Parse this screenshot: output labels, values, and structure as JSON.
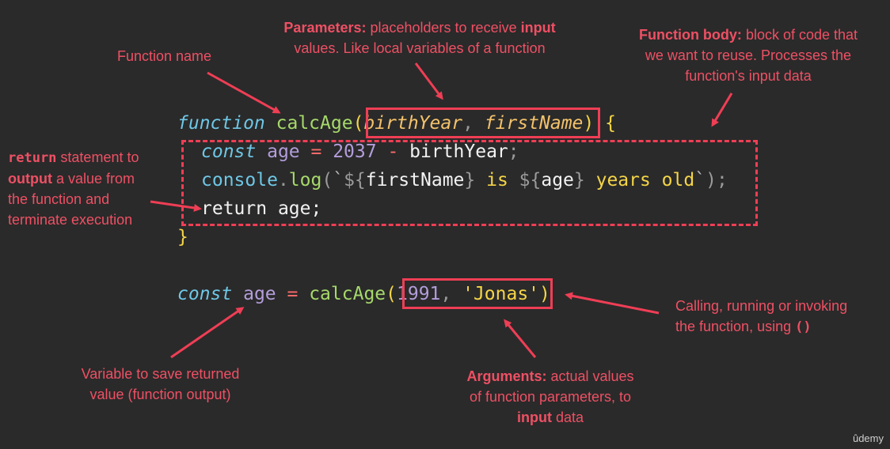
{
  "annotations": {
    "function_name": "Function name",
    "parameters": {
      "bold": "Parameters:",
      "text1": " placeholders to receive ",
      "bold2": "input",
      "line2": "values. Like local variables of a function"
    },
    "function_body": {
      "bold": "Function body:",
      "text1": " block of code that",
      "line2": "we want to reuse. Processes the",
      "line3": "function's input data"
    },
    "return_statement": {
      "mono": "return",
      "text1": " statement to",
      "bold2": "output",
      "text2": " a value from",
      "line3": "the function and",
      "line4": "terminate execution"
    },
    "calling": {
      "line1": "Calling, running or invoking",
      "line2": "the function, using ",
      "mono": "()"
    },
    "variable": {
      "line1": "Variable to save returned",
      "line2": "value (function output)"
    },
    "arguments": {
      "bold": "Arguments:",
      "text1": " actual values",
      "line2": "of function parameters, to",
      "bold3": "input",
      "text3": " data"
    }
  },
  "code": {
    "function_kw": "function",
    "fn_name": "calcAge",
    "open_paren": "(",
    "param1": "birthYear",
    "comma": ", ",
    "param2": "firstName",
    "close_paren": ")",
    "open_brace": " {",
    "const_kw": "const",
    "age_var": " age ",
    "eq": "=",
    "year": " 2037 ",
    "minus": "-",
    "birth_ref": " birthYear",
    "semi": ";",
    "console": "console",
    "dot": ".",
    "log": "log",
    "log_open": "(",
    "tick": "`",
    "tpl_open": "${",
    "first_ref": "firstName",
    "tpl_close": "}",
    "is_text": " is ",
    "age_ref": "age",
    "years_text": " years old",
    "log_close": ");",
    "return_kw": "return",
    "return_val": " age;",
    "close_brace": "}",
    "call_const": "const",
    "call_age": " age ",
    "call_eq": "=",
    "call_fn": " calcAge",
    "call_open": "(",
    "arg1": "1991",
    "arg_comma": ", ",
    "arg2": "'Jonas'",
    "call_close": ")"
  },
  "logo": "ûdemy",
  "colors": {
    "background": "#2a2a2a",
    "annotation": "#ef5064",
    "box": "#ef3e55"
  }
}
